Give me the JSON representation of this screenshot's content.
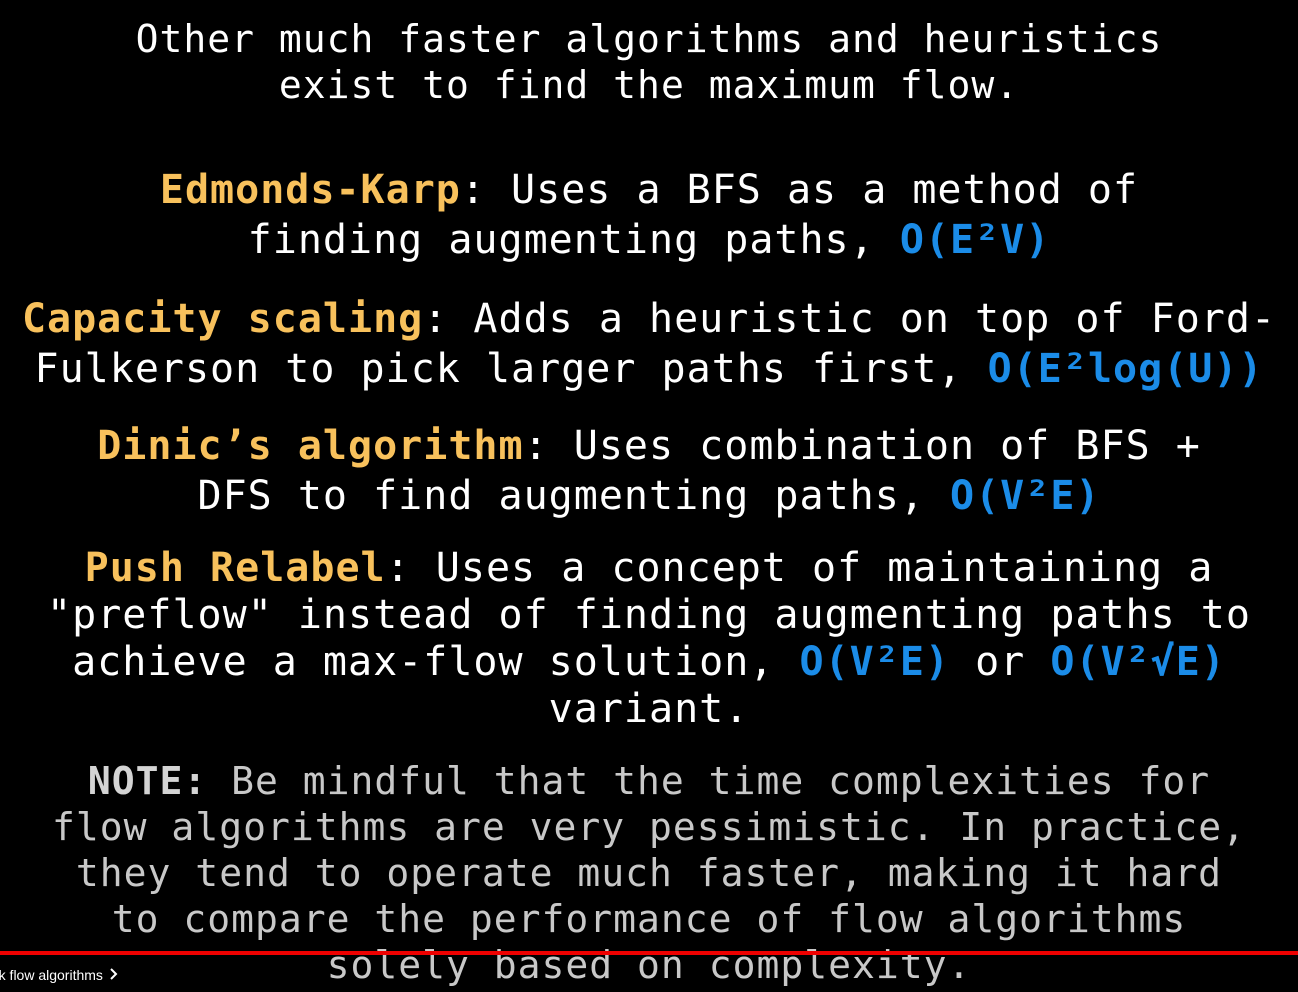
{
  "slide": {
    "intro": [
      "Other much faster algorithms and heuristics",
      "exist to find the maximum flow."
    ],
    "edmonds_karp": {
      "name": "Edmonds-Karp",
      "line1_rest": ": Uses a BFS as a method of",
      "line2": "finding augmenting paths, ",
      "complexity": "O(E²V)"
    },
    "capacity_scaling": {
      "name": "Capacity scaling",
      "line1_rest": ": Adds a heuristic on top of Ford-",
      "line2": "Fulkerson to pick larger paths first, ",
      "complexity": "O(E²log(U))"
    },
    "dinic": {
      "name": "Dinic’s algorithm",
      "line1_rest": ": Uses combination of BFS +",
      "line2": "DFS to find augmenting paths, ",
      "complexity": "O(V²E)"
    },
    "push_relabel": {
      "name": "Push Relabel",
      "line1_rest": ": Uses a concept of maintaining a",
      "line2": "\"preflow\" instead of finding augmenting paths to",
      "line3": "achieve a max-flow solution, ",
      "complexity1": "O(V²E)",
      "or": " or ",
      "complexity2": "O(V²√E)",
      "line4": "variant."
    },
    "note": {
      "label": "NOTE:",
      "line1_rest": " Be mindful that the time complexities for",
      "lines": [
        "flow algorithms are very pessimistic. In practice,",
        "they tend to operate much faster, making it hard",
        "to compare the performance of flow algorithms",
        "solely based on complexity."
      ]
    }
  },
  "player": {
    "chapter_label": "rk flow algorithms",
    "chapter_icon": "chevron-right-icon",
    "progress_fraction": 1.0,
    "progress_color": "#ee0000"
  },
  "colors": {
    "background": "#000000",
    "algorithm_name": "#f8c15c",
    "complexity": "#1b8ce8",
    "text": "#ffffff",
    "note_text": "#c8c8c8"
  }
}
